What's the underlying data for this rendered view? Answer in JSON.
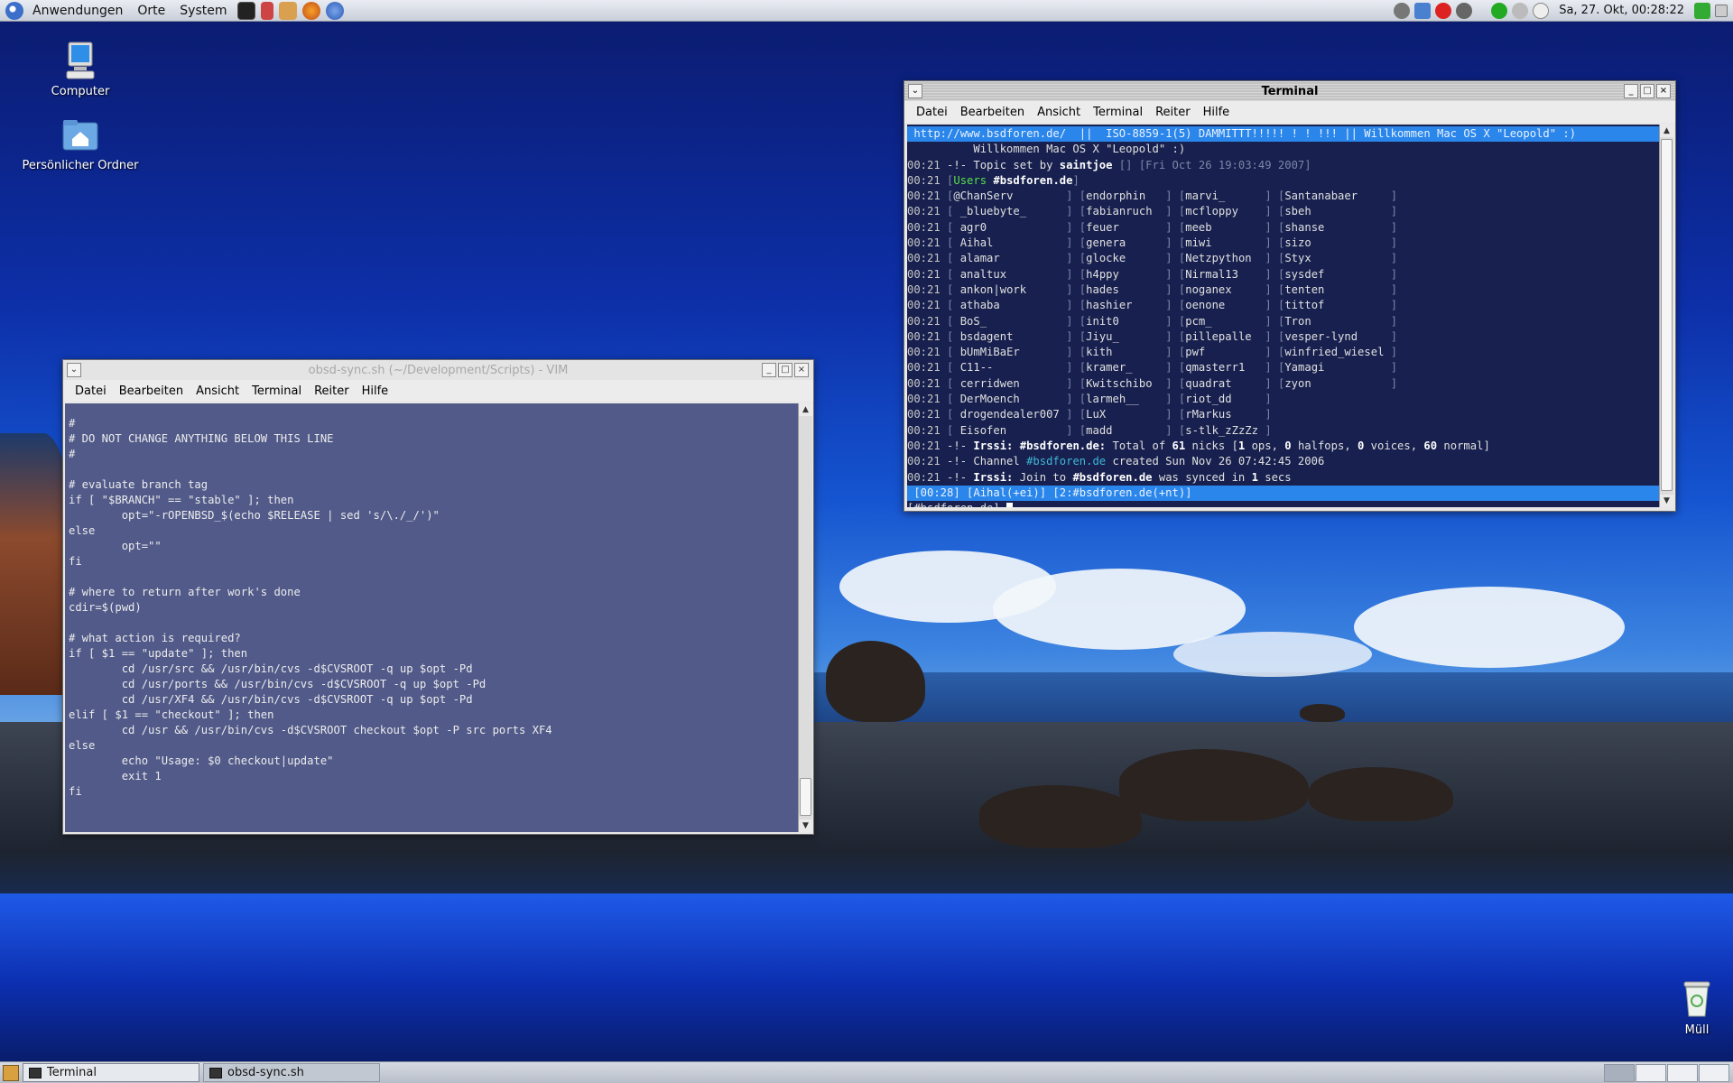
{
  "top_panel": {
    "menus": [
      "Anwendungen",
      "Orte",
      "System"
    ],
    "clock": "Sa, 27. Okt, 00:28:22",
    "launchers": [
      "terminal-launcher",
      "text-editor-launcher",
      "mail-launcher",
      "firefox-launcher",
      "thunderbird-launcher"
    ],
    "tray_icons": [
      "settings-icon",
      "network-icon",
      "power-icon",
      "shutdown-icon",
      "check-icon",
      "globe-icon",
      "speech-icon"
    ]
  },
  "desktop_icons": [
    {
      "label": "Computer",
      "icon": "computer-icon"
    },
    {
      "label": "Persönlicher Ordner",
      "icon": "home-folder-icon"
    },
    {
      "label": "Müll",
      "icon": "trash-icon"
    }
  ],
  "vim_window": {
    "title": "obsd-sync.sh (~/Development/Scripts) - VIM",
    "menu": [
      "Datei",
      "Bearbeiten",
      "Ansicht",
      "Terminal",
      "Reiter",
      "Hilfe"
    ],
    "lines": [
      "#",
      "# DO NOT CHANGE ANYTHING BELOW THIS LINE",
      "#",
      "",
      "# evaluate branch tag",
      "if [ \"$BRANCH\" == \"stable\" ]; then",
      "        opt=\"-rOPENBSD_$(echo $RELEASE | sed 's/\\./_/')\"",
      "else",
      "        opt=\"\"",
      "fi",
      "",
      "# where to return after work's done",
      "cdir=$(pwd)",
      "",
      "# what action is required?",
      "if [ $1 == \"update\" ]; then",
      "        cd /usr/src && /usr/bin/cvs -d$CVSROOT -q up $opt -Pd",
      "        cd /usr/ports && /usr/bin/cvs -d$CVSROOT -q up $opt -Pd",
      "        cd /usr/XF4 && /usr/bin/cvs -d$CVSROOT -q up $opt -Pd",
      "elif [ $1 == \"checkout\" ]; then",
      "        cd /usr && /usr/bin/cvs -d$CVSROOT checkout $opt -P src ports XF4",
      "else",
      "        echo \"Usage: $0 checkout|update\"",
      "        exit 1",
      "fi"
    ]
  },
  "terminal_window": {
    "title": "Terminal",
    "menu": [
      "Datei",
      "Bearbeiten",
      "Ansicht",
      "Terminal",
      "Reiter",
      "Hilfe"
    ],
    "topic": " http://www.bsdforen.de/  ||  ISO-8859-1(5) DAMMITTT!!!!! ! ! !!! || Willkommen Mac OS X \"Leopold\" :)",
    "topic_cont": "          Willkommen Mac OS X \"Leopold\" :)",
    "topic_line": {
      "time": "00:21",
      "prefix": " -!- Topic set by ",
      "by": "saintjoe",
      "rest": " [] [Fri Oct 26 19:03:49 2007]"
    },
    "users_line": {
      "time": "00:21",
      "pre": " [",
      "label": "Users",
      "chan": "#bsdforen.de",
      "post": "]"
    },
    "nick_rows": [
      [
        "@ChanServ",
        "endorphin",
        "marvi_",
        "Santanabaer"
      ],
      [
        " _bluebyte_",
        "fabianruch",
        "mcfloppy",
        "sbeh"
      ],
      [
        " agr0",
        "feuer",
        "meeb",
        "shanse"
      ],
      [
        " Aihal",
        "genera",
        "miwi",
        "sizo"
      ],
      [
        " alamar",
        "glocke",
        "Netzpython",
        "Styx"
      ],
      [
        " analtux",
        "h4ppy",
        "Nirmal13",
        "sysdef"
      ],
      [
        " ankon|work",
        "hades",
        "noganex",
        "tenten"
      ],
      [
        " athaba",
        "hashier",
        "oenone",
        "tittof"
      ],
      [
        " BoS_",
        "init0",
        "pcm_",
        "Tron"
      ],
      [
        " bsdagent",
        "Jiyu_",
        "pillepalle",
        "vesper-lynd"
      ],
      [
        " bUmMiBaEr",
        "kith",
        "pwf",
        "winfried_wiesel"
      ],
      [
        " C11--",
        "kramer_",
        "qmasterr1",
        "Yamagi"
      ],
      [
        " cerridwen",
        "Kwitschibo",
        "quadrat",
        "zyon"
      ],
      [
        " DerMoench",
        "larmeh__",
        "riot_dd",
        ""
      ],
      [
        " drogendealer007",
        "LuX",
        "rMarkus",
        ""
      ],
      [
        " Eisofen",
        "madd",
        "s-tlk_zZzZz",
        ""
      ]
    ],
    "nick_time": "00:21",
    "total_line": {
      "time": "00:21",
      "pre": " -!- ",
      "irssi": "Irssi:",
      "chan": " #bsdforen.de:",
      "t1": " Total of ",
      "n1": "61",
      "t2": " nicks [",
      "n2": "1",
      "t3": " ops, ",
      "n3": "0",
      "t4": " halfops, ",
      "n4": "0",
      "t5": " voices, ",
      "n5": "60",
      "t6": " normal]"
    },
    "channel_line": {
      "time": "00:21",
      "pre": " -!- Channel ",
      "chan": "#bsdforen.de",
      "post": " created Sun Nov 26 07:42:45 2006"
    },
    "join_line": {
      "time": "00:21",
      "pre": " -!- ",
      "irssi": "Irssi:",
      "t1": " Join to ",
      "chan": "#bsdforen.de",
      "t2": " was synced in ",
      "n": "1",
      "t3": " secs"
    },
    "statusbar": " [00:28] [Aihal(+ei)] [2:#bsdforen.de(+nt)]",
    "prompt": "[#bsdforen.de] "
  },
  "taskbar": {
    "tasks": [
      "Terminal",
      "obsd-sync.sh"
    ]
  }
}
